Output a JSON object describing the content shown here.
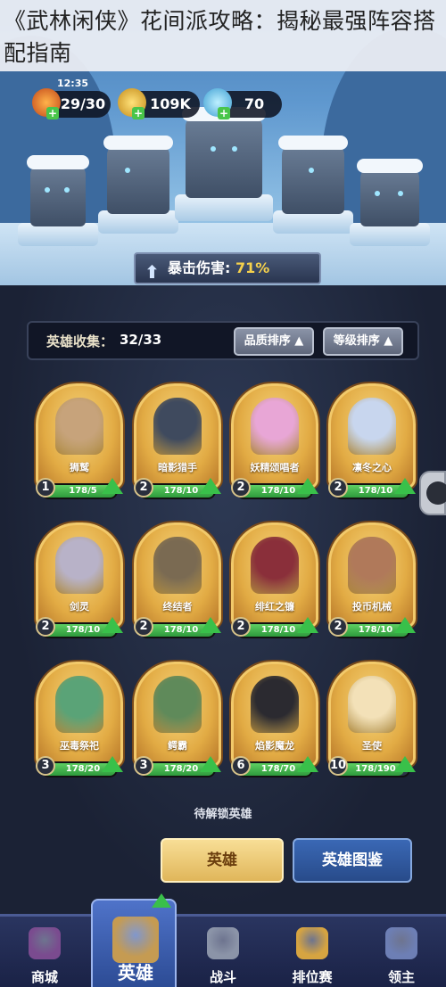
{
  "article": {
    "title": "《武林闲侠》花间派攻略：揭秘最强阵容搭配指南"
  },
  "status": {
    "time": "12:35"
  },
  "resources": {
    "energy": "29/30",
    "gold": "109K",
    "gems": "70"
  },
  "banner": {
    "label": "暴击伤害: ",
    "value": "71%"
  },
  "collection": {
    "label": "英雄收集：",
    "count": "32/33",
    "sort_quality": "品质排序 ▲",
    "sort_level": "等级排序 ▲"
  },
  "heroes": [
    {
      "name": "狮鹫",
      "level": "1",
      "progress": "178/5",
      "fill": 1.0,
      "color": "#c7a37b"
    },
    {
      "name": "暗影猎手",
      "level": "2",
      "progress": "178/10",
      "fill": 1.0,
      "color": "#3f4a5e"
    },
    {
      "name": "妖精颂唱者",
      "level": "2",
      "progress": "178/10",
      "fill": 1.0,
      "color": "#e8a6d6"
    },
    {
      "name": "凛冬之心",
      "level": "2",
      "progress": "178/10",
      "fill": 1.0,
      "color": "#c8d6ee"
    },
    {
      "name": "剑灵",
      "level": "2",
      "progress": "178/10",
      "fill": 1.0,
      "color": "#b8b2c8"
    },
    {
      "name": "终结者",
      "level": "2",
      "progress": "178/10",
      "fill": 1.0,
      "color": "#7a6a52"
    },
    {
      "name": "绯红之镰",
      "level": "2",
      "progress": "178/10",
      "fill": 1.0,
      "color": "#8a2f3a"
    },
    {
      "name": "投币机械",
      "level": "2",
      "progress": "178/10",
      "fill": 1.0,
      "color": "#b0795a"
    },
    {
      "name": "巫毒祭祀",
      "level": "3",
      "progress": "178/20",
      "fill": 1.0,
      "color": "#5aa377"
    },
    {
      "name": "鳄霸",
      "level": "3",
      "progress": "178/20",
      "fill": 1.0,
      "color": "#5f8a5a"
    },
    {
      "name": "焰影魔龙",
      "level": "6",
      "progress": "178/70",
      "fill": 1.0,
      "color": "#2b2a30"
    },
    {
      "name": "圣使",
      "level": "10",
      "progress": "178/190",
      "fill": 0.94,
      "color": "#f3e1b8"
    }
  ],
  "locked_label": "待解锁英雄",
  "buttons": {
    "hero": "英雄",
    "guide": "英雄图鉴"
  },
  "nav": [
    {
      "label": "商城",
      "icon": "shop-icon",
      "color": "#7a4b8f"
    },
    {
      "label": "英雄",
      "icon": "hero-card-icon",
      "color": "#c59b52"
    },
    {
      "label": "战斗",
      "icon": "crossed-swords-icon",
      "color": "#8b94a8"
    },
    {
      "label": "排位赛",
      "icon": "rank-shield-icon",
      "color": "#d6a441"
    },
    {
      "label": "领主",
      "icon": "lord-banner-icon",
      "color": "#6d7fb5"
    }
  ],
  "colors": {
    "energy": "#e86a2a",
    "gold": "#e6b938",
    "gems": "#6fcaf0"
  }
}
